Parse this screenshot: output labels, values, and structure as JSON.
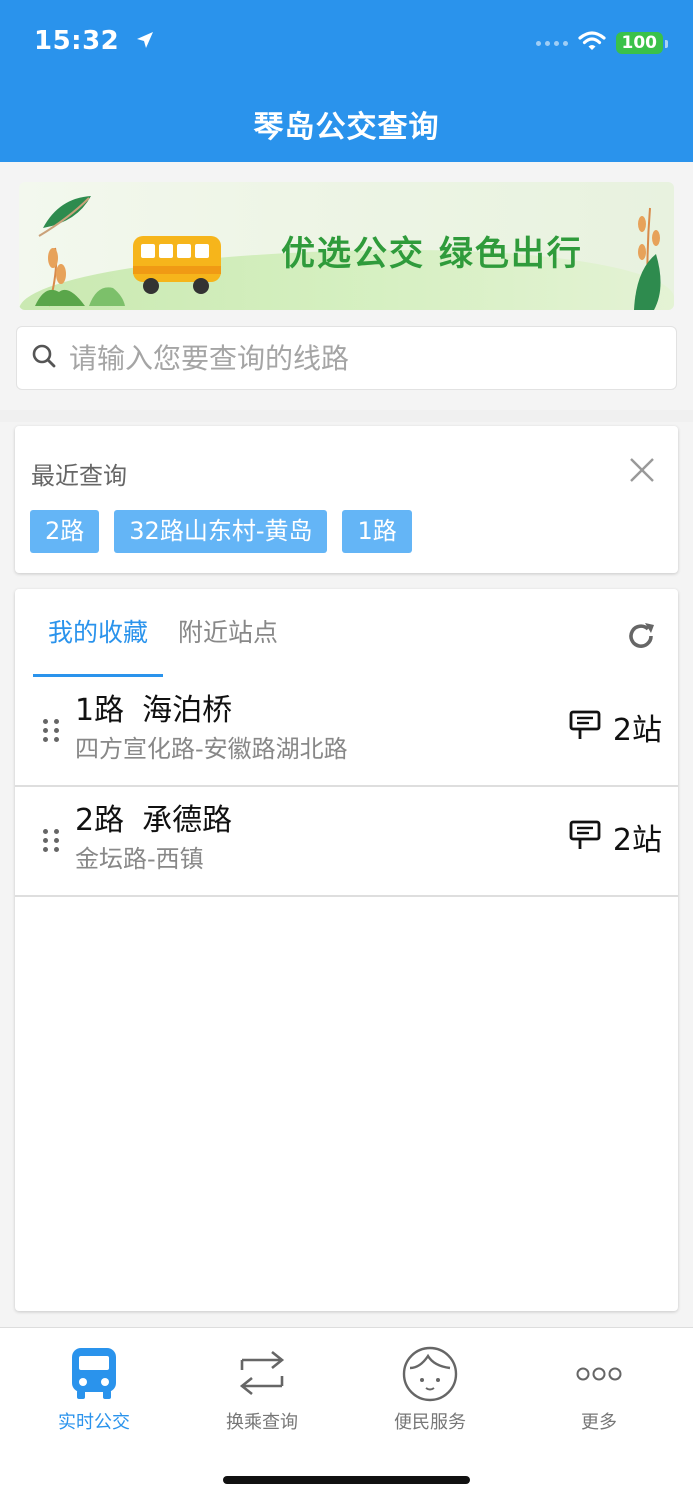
{
  "status_bar": {
    "time": "15:32",
    "battery": "100"
  },
  "header": {
    "title": "琴岛公交查询"
  },
  "banner": {
    "slogan": "优选公交 绿色出行"
  },
  "search": {
    "placeholder": "请输入您要查询的线路"
  },
  "recent": {
    "title": "最近查询",
    "chips": [
      "2路",
      "32路山东村-黄岛",
      "1路"
    ]
  },
  "favorites": {
    "tabs": [
      {
        "label": "我的收藏",
        "active": true
      },
      {
        "label": "附近站点",
        "active": false
      }
    ],
    "rows": [
      {
        "route": "1路",
        "station": "海泊桥",
        "direction": "四方宣化路-安徽路湖北路",
        "stops": "2站"
      },
      {
        "route": "2路",
        "station": "承德路",
        "direction": "金坛路-西镇",
        "stops": "2站"
      }
    ]
  },
  "bottom_nav": {
    "items": [
      {
        "label": "实时公交",
        "icon": "bus-icon",
        "active": true
      },
      {
        "label": "换乘查询",
        "icon": "transfer-icon",
        "active": false
      },
      {
        "label": "便民服务",
        "icon": "face-icon",
        "active": false
      },
      {
        "label": "更多",
        "icon": "more-icon",
        "active": false
      }
    ]
  },
  "colors": {
    "primary": "#2a93ec",
    "chip": "#64b5f6",
    "banner_text": "#2f9b3b",
    "battery": "#3ac14a"
  }
}
